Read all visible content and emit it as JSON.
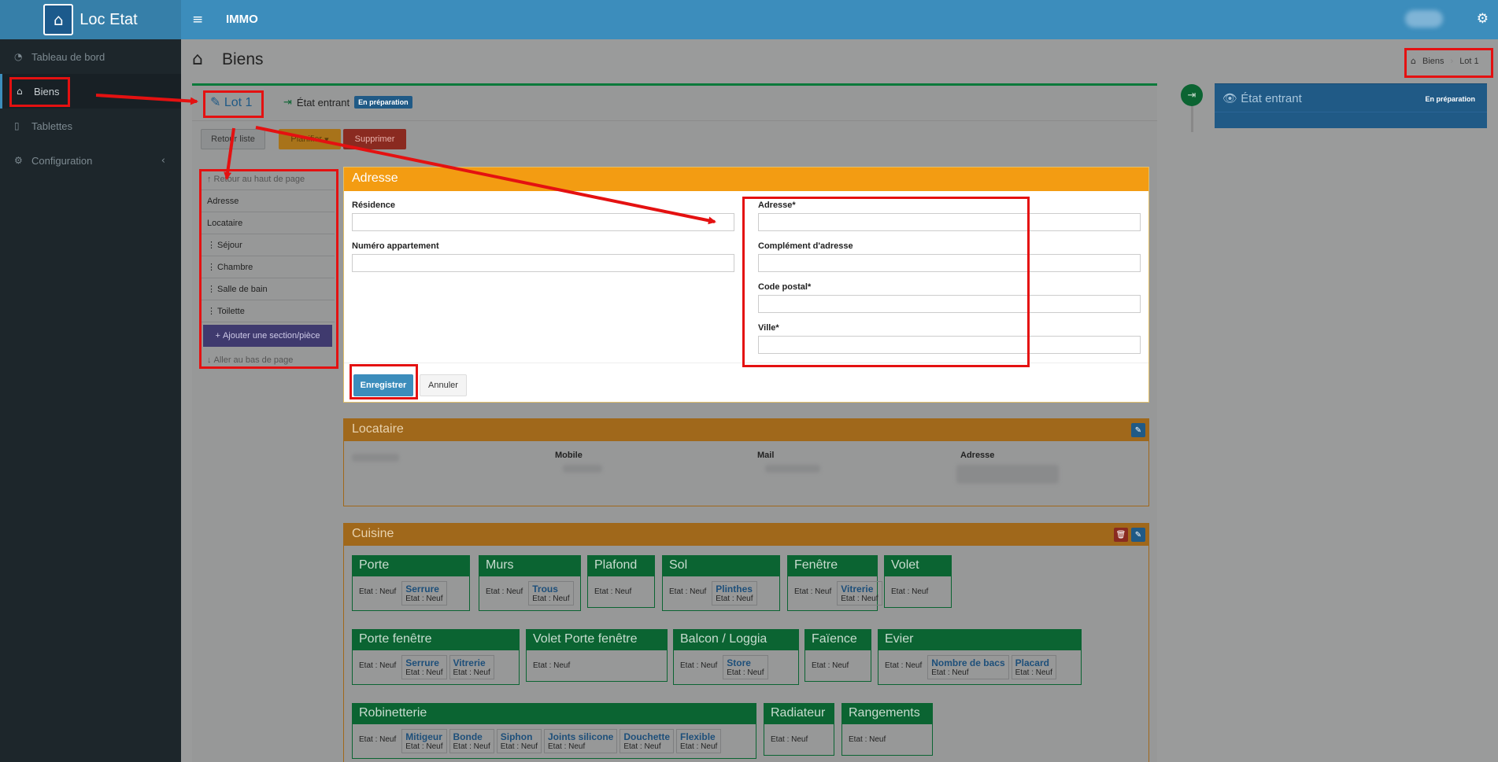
{
  "brand": {
    "name": "Loc Etat",
    "logo_icon": "house-checklist-icon"
  },
  "topbar": {
    "title": "IMMO"
  },
  "sidebar": {
    "items": [
      {
        "label": "Tableau de bord",
        "icon": "dashboard-icon"
      },
      {
        "label": "Biens",
        "icon": "home-icon"
      },
      {
        "label": "Tablettes",
        "icon": "tablet-icon"
      },
      {
        "label": "Configuration",
        "icon": "cogs-icon"
      }
    ]
  },
  "page": {
    "title": "Biens"
  },
  "breadcrumb": {
    "home": "Biens",
    "current": "Lot 1"
  },
  "tabs": {
    "lot": "Lot 1",
    "etat": "État entrant",
    "badge": "En préparation"
  },
  "actions": {
    "retour": "Retour liste",
    "planifier": "Planifier",
    "supprimer": "Supprimer"
  },
  "toc": {
    "top": "Retour au haut de page",
    "items": [
      "Adresse",
      "Locataire",
      "Séjour",
      "Chambre",
      "Salle de bain",
      "Toilette"
    ],
    "add": "Ajouter une section/pièce",
    "bottom": "Aller au bas de page"
  },
  "adresse": {
    "title": "Adresse",
    "residence": {
      "label": "Résidence",
      "value": ""
    },
    "numero": {
      "label": "Numéro appartement",
      "value": ""
    },
    "adresse": {
      "label": "Adresse*",
      "value": ""
    },
    "complement": {
      "label": "Complément d'adresse",
      "value": ""
    },
    "cp": {
      "label": "Code postal*",
      "value": ""
    },
    "ville": {
      "label": "Ville*",
      "value": ""
    },
    "save": "Enregistrer",
    "cancel": "Annuler"
  },
  "locataire": {
    "title": "Locataire",
    "mobile": "Mobile",
    "mail": "Mail",
    "adresse": "Adresse"
  },
  "cuisine": {
    "title": "Cuisine",
    "etat_neuf": "Etat : Neuf",
    "cards": [
      {
        "name": "Porte",
        "subs": [
          "Serrure"
        ]
      },
      {
        "name": "Murs",
        "subs": [
          "Trous"
        ]
      },
      {
        "name": "Plafond",
        "subs": []
      },
      {
        "name": "Sol",
        "subs": [
          "Plinthes"
        ]
      },
      {
        "name": "Fenêtre",
        "subs": [
          "Vitrerie"
        ]
      },
      {
        "name": "Volet",
        "subs": []
      },
      {
        "name": "Porte fenêtre",
        "subs": [
          "Serrure",
          "Vitrerie"
        ]
      },
      {
        "name": "Volet Porte fenêtre",
        "subs": []
      },
      {
        "name": "Balcon / Loggia",
        "subs": [
          "Store"
        ]
      },
      {
        "name": "Faïence",
        "subs": []
      },
      {
        "name": "Evier",
        "subs": [
          "Nombre de bacs",
          "Placard"
        ]
      },
      {
        "name": "Robinetterie",
        "subs": [
          "Mitigeur",
          "Bonde",
          "Siphon",
          "Joints silicone",
          "Douchette",
          "Flexible"
        ]
      },
      {
        "name": "Radiateur",
        "subs": []
      },
      {
        "name": "Rangements",
        "subs": []
      }
    ]
  },
  "right_panel": {
    "title": "État entrant",
    "badge": "En préparation"
  },
  "colors": {
    "topbar": "#3c8dbc",
    "sidebar": "#1d262b",
    "orange": "#f39c12",
    "green": "#0b6432",
    "highlight": "#e41111"
  }
}
